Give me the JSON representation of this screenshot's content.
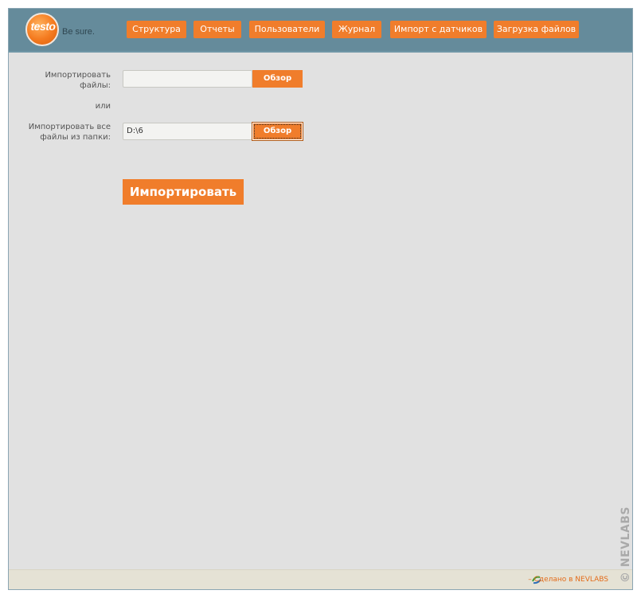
{
  "header": {
    "logo": {
      "word": "testo",
      "tagline": "Be sure."
    },
    "nav": [
      {
        "label": "Структура"
      },
      {
        "label": "Отчеты"
      },
      {
        "label": "Пользователи"
      },
      {
        "label": "Журнал"
      },
      {
        "label": "Импорт с датчиков"
      },
      {
        "label": "Загрузка файлов"
      }
    ]
  },
  "form": {
    "files_label": "Импортировать\nфайлы:",
    "files_value": "",
    "browse1_label": "Обзор",
    "or_label": "или",
    "folder_label": "Импортировать все\nфайлы из папки:",
    "folder_value": "D:\\6",
    "browse2_label": "Обзор",
    "import_label": "Импортировать"
  },
  "footer": {
    "text": "– Сделано в NEVLABS"
  },
  "watermark": "© NEVLABS",
  "colors": {
    "accent": "#f07d2b",
    "header": "#658b9b",
    "content": "#e1e1e1"
  }
}
